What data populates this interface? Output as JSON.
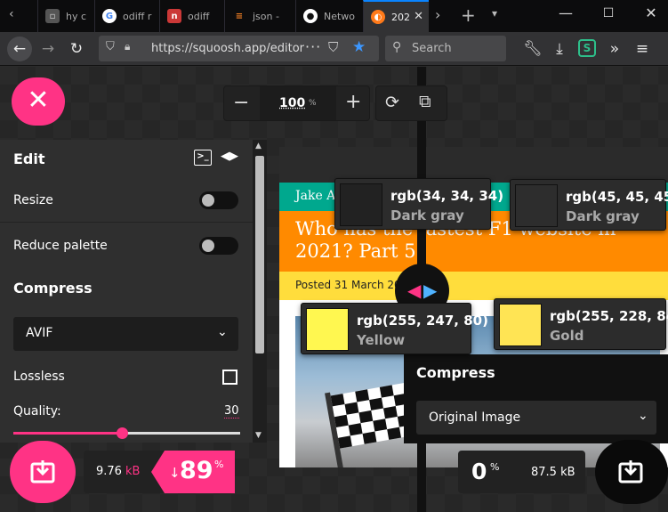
{
  "browser": {
    "tabs": [
      {
        "label": "hy c",
        "icon": "page-icon"
      },
      {
        "label": "odiff r",
        "icon": "google-icon"
      },
      {
        "label": "odiff",
        "icon": "npm-icon"
      },
      {
        "label": "json -",
        "icon": "stackoverflow-icon"
      },
      {
        "label": "Netwo",
        "icon": "github-icon"
      },
      {
        "label": "202",
        "icon": "squoosh-icon"
      }
    ],
    "url": "https://squoosh.app/editor",
    "search_placeholder": "Search"
  },
  "zoom": {
    "value": "100",
    "unit": "%"
  },
  "edit": {
    "title": "Edit",
    "resize_label": "Resize",
    "reduce_palette_label": "Reduce palette"
  },
  "compress_left": {
    "title": "Compress",
    "codec": "AVIF",
    "lossless_label": "Lossless",
    "quality_label": "Quality:",
    "quality_value": "30",
    "quality_level": 0.3
  },
  "results_left": {
    "size": "9.76",
    "size_unit": "kB",
    "percent": "89",
    "percent_sign": "%",
    "arrow": "↓"
  },
  "results_right": {
    "percent": "0",
    "percent_sign": "%",
    "size": "87.5 kB"
  },
  "compress_right": {
    "title": "Compress",
    "codec": "Original Image"
  },
  "article": {
    "author": "Jake A",
    "title_line1": "Who has the fastest F1 website in",
    "title_line2": "2021? Part 5",
    "posted": "Posted 31 March 202"
  },
  "swatches": [
    {
      "rgb": "rgb(34, 34, 34)",
      "name": "Dark gray",
      "color": "#222222"
    },
    {
      "rgb": "rgb(45, 45, 45)",
      "name": "Dark gray",
      "color": "#2d2d2d"
    },
    {
      "rgb": "rgb(255, 247, 80)",
      "name": "Yellow",
      "color": "#fff750"
    },
    {
      "rgb": "rgb(255, 228, 84)",
      "name": "Gold",
      "color": "#ffe454"
    }
  ],
  "colors": {
    "accent": "#ff3385",
    "panel": "#2f2f2f",
    "banner_orange": "#ff8a00",
    "banner_teal": "#00a88e",
    "posted_yellow": "#ffdd3c"
  }
}
